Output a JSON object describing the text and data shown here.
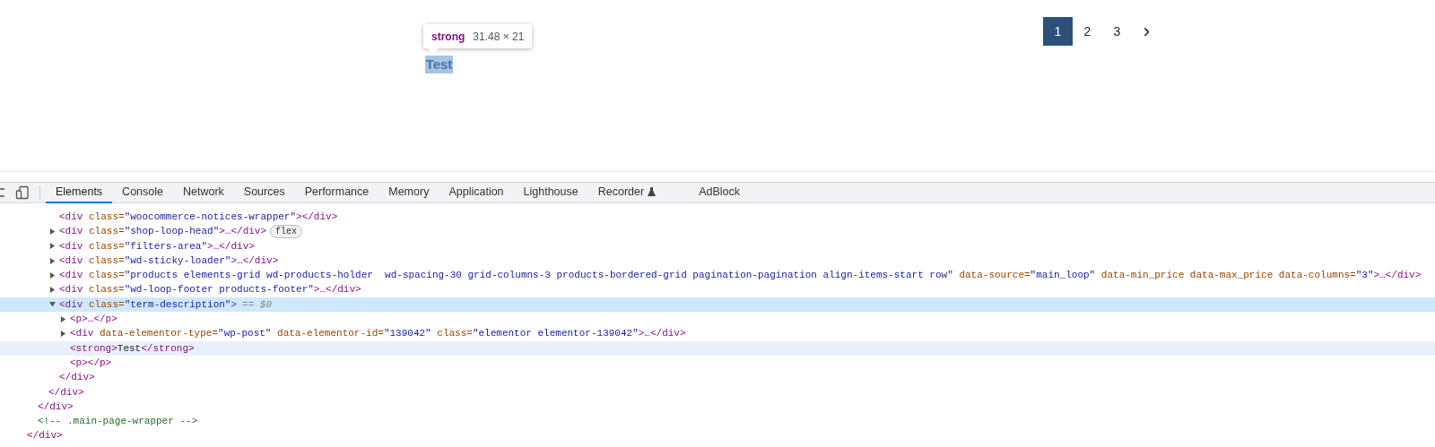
{
  "page": {
    "selected_text": "Test",
    "tooltip": {
      "tag": "strong",
      "size": "31.48 × 21"
    },
    "pagination": [
      {
        "label": "1",
        "selected": true
      },
      {
        "label": "2",
        "selected": false
      },
      {
        "label": "3",
        "selected": false
      },
      {
        "label": "›",
        "kind": "next",
        "selected": false
      }
    ]
  },
  "devtools": {
    "tabs": [
      {
        "label": "Elements",
        "selected": true
      },
      {
        "label": "Console",
        "selected": false
      },
      {
        "label": "Network",
        "selected": false
      },
      {
        "label": "Sources",
        "selected": false
      },
      {
        "label": "Performance",
        "selected": false
      },
      {
        "label": "Memory",
        "selected": false
      },
      {
        "label": "Application",
        "selected": false
      },
      {
        "label": "Lighthouse",
        "selected": false
      },
      {
        "label": "Recorder",
        "selected": false,
        "experimental": true
      },
      {
        "label": "AdBlock",
        "selected": false
      }
    ],
    "tree": [
      {
        "close": [
          {
            "kind": "tag",
            "text": "</div>"
          }
        ],
        "children": [
          {
            "close": [
              {
                "kind": "tag",
                "text": "</div>"
              }
            ],
            "children": [
              {
                "close": [
                  {
                    "kind": "tag",
                    "text": "</div>"
                  }
                ],
                "children": [
                  {
                    "selected": false,
                    "hovered": false,
                    "tokens": [
                      {
                        "kind": "tag",
                        "text": "<div"
                      },
                      {
                        "kind": "attr",
                        "text": " class="
                      },
                      {
                        "kind": "value",
                        "text": "\"woocommerce-notices-wrapper\""
                      },
                      {
                        "kind": "tag",
                        "text": "></div>"
                      }
                    ]
                  },
                  {
                    "selected": false,
                    "hovered": false,
                    "expanded": false,
                    "badge": "flex",
                    "tokens": [
                      {
                        "kind": "tag",
                        "text": "<div"
                      },
                      {
                        "kind": "attr",
                        "text": " class="
                      },
                      {
                        "kind": "value",
                        "text": "\"shop-loop-head\""
                      },
                      {
                        "kind": "tag",
                        "text": ">…</div>"
                      }
                    ]
                  },
                  {
                    "selected": false,
                    "hovered": false,
                    "expanded": false,
                    "tokens": [
                      {
                        "kind": "tag",
                        "text": "<div"
                      },
                      {
                        "kind": "attr",
                        "text": " class="
                      },
                      {
                        "kind": "value",
                        "text": "\"filters-area\""
                      },
                      {
                        "kind": "tag",
                        "text": ">…</div>"
                      }
                    ]
                  },
                  {
                    "selected": false,
                    "hovered": false,
                    "expanded": false,
                    "tokens": [
                      {
                        "kind": "tag",
                        "text": "<div"
                      },
                      {
                        "kind": "attr",
                        "text": " class="
                      },
                      {
                        "kind": "value",
                        "text": "\"wd-sticky-loader\""
                      },
                      {
                        "kind": "tag",
                        "text": ">…</div>"
                      }
                    ]
                  },
                  {
                    "selected": false,
                    "hovered": false,
                    "expanded": false,
                    "tokens": [
                      {
                        "kind": "tag",
                        "text": "<div"
                      },
                      {
                        "kind": "attr",
                        "text": " class="
                      },
                      {
                        "kind": "value",
                        "text": "\"products elements-grid wd-products-holder  wd-spacing-30 grid-columns-3 products-bordered-grid pagination-pagination align-items-start row\""
                      },
                      {
                        "kind": "attr",
                        "text": " data-source="
                      },
                      {
                        "kind": "value",
                        "text": "\"main_loop\""
                      },
                      {
                        "kind": "attr",
                        "text": " data-min_price data-max_price data-columns="
                      },
                      {
                        "kind": "value",
                        "text": "\"3\""
                      },
                      {
                        "kind": "tag",
                        "text": ">…</div>"
                      }
                    ]
                  },
                  {
                    "selected": false,
                    "hovered": false,
                    "expanded": false,
                    "tokens": [
                      {
                        "kind": "tag",
                        "text": "<div"
                      },
                      {
                        "kind": "attr",
                        "text": " class="
                      },
                      {
                        "kind": "value",
                        "text": "\"wd-loop-footer products-footer\""
                      },
                      {
                        "kind": "tag",
                        "text": ">…</div>"
                      }
                    ]
                  },
                  {
                    "selected": true,
                    "hovered": false,
                    "expanded": true,
                    "marker": "== $0",
                    "tokens": [
                      {
                        "kind": "tag",
                        "text": "<div"
                      },
                      {
                        "kind": "attr",
                        "text": " class="
                      },
                      {
                        "kind": "value",
                        "text": "\"term-description\""
                      },
                      {
                        "kind": "tag",
                        "text": ">"
                      }
                    ],
                    "close": [
                      {
                        "kind": "tag",
                        "text": "</div>"
                      }
                    ],
                    "children": [
                      {
                        "selected": false,
                        "hovered": false,
                        "expanded": false,
                        "tokens": [
                          {
                            "kind": "tag",
                            "text": "<p>…</p>"
                          }
                        ]
                      },
                      {
                        "selected": false,
                        "hovered": false,
                        "expanded": false,
                        "tokens": [
                          {
                            "kind": "tag",
                            "text": "<div"
                          },
                          {
                            "kind": "attr",
                            "text": " data-elementor-type="
                          },
                          {
                            "kind": "value",
                            "text": "\"wp-post\""
                          },
                          {
                            "kind": "attr",
                            "text": " data-elementor-id="
                          },
                          {
                            "kind": "value",
                            "text": "\"139042\""
                          },
                          {
                            "kind": "attr",
                            "text": " class="
                          },
                          {
                            "kind": "value",
                            "text": "\"elementor elementor-139042\""
                          },
                          {
                            "kind": "tag",
                            "text": ">…</div>"
                          }
                        ]
                      },
                      {
                        "selected": false,
                        "hovered": true,
                        "tokens": [
                          {
                            "kind": "tag",
                            "text": "<strong>"
                          },
                          {
                            "kind": "text",
                            "text": "Test"
                          },
                          {
                            "kind": "tag",
                            "text": "</strong>"
                          }
                        ]
                      },
                      {
                        "selected": false,
                        "hovered": false,
                        "tokens": [
                          {
                            "kind": "tag",
                            "text": "<p></p>"
                          }
                        ]
                      }
                    ]
                  }
                ]
              }
            ]
          },
          {
            "tokens": [
              {
                "kind": "comment",
                "text": "<!-- .main-page-wrapper -->"
              }
            ]
          }
        ]
      }
    ]
  }
}
